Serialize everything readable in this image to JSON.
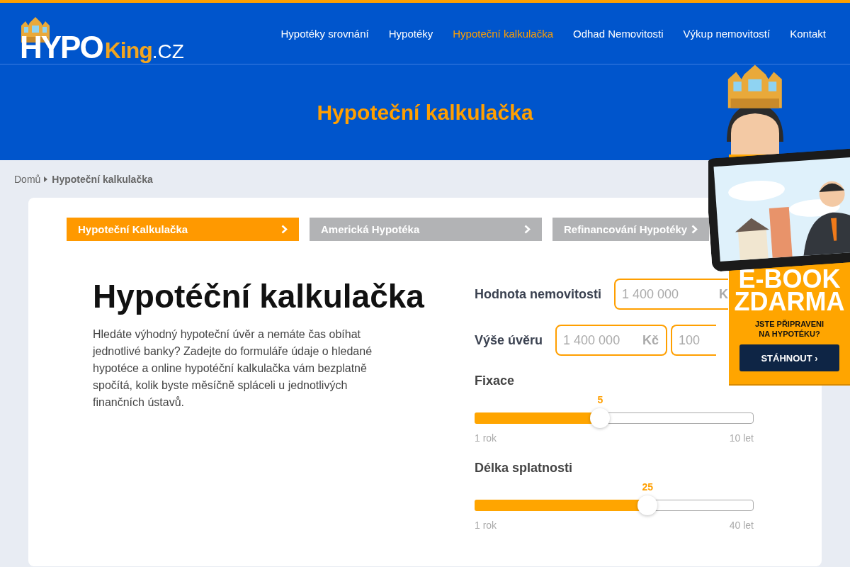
{
  "logo": {
    "part_1": "HYPO",
    "part_2": "King",
    "part_3": ".CZ"
  },
  "nav": [
    {
      "label": "Hypotéky srovnání",
      "selected": false
    },
    {
      "label": "Hypotéky",
      "selected": false
    },
    {
      "label": "Hypoteční kalkulačka",
      "selected": true
    },
    {
      "label": "Odhad Nemovitosti",
      "selected": false
    },
    {
      "label": "Výkup nemovitostí",
      "selected": false
    },
    {
      "label": "Kontakt",
      "selected": false
    }
  ],
  "hero": {
    "title": "Hypoteční kalkulačka"
  },
  "breadcrumb": [
    {
      "label": "Domů"
    },
    {
      "label": "Hypoteční kalkulačka"
    }
  ],
  "tabs": [
    {
      "label": "Hypoteční Kalkulačka",
      "selected": true
    },
    {
      "label": "Americká Hypotéka",
      "selected": false
    },
    {
      "label": "Refinancování Hypotéky",
      "selected": false
    }
  ],
  "intro": {
    "title": "Hypotéční kalkulačka",
    "text": "Hledáte výhodný hypoteční úvěr a nemáte čas obíhat jednotlivé banky? Zadejte do formuláře údaje o hledané hypotéce a online hypotéční kalkulačka vám bezplatně spočítá, kolik byste měsíčně spláceli u jednotlivých finančních ústavů."
  },
  "form": [
    {
      "kind": "fields",
      "label": "Hodnota nemovitosti",
      "fields": [
        {
          "placeholder": "1 400 000",
          "unit": "K"
        }
      ]
    },
    {
      "kind": "fields",
      "label": "Výše úvěru",
      "fields": [
        {
          "placeholder": "1 400 000",
          "unit": "Kč"
        },
        {
          "placeholder": "100"
        }
      ]
    },
    {
      "kind": "slider",
      "label": "Fixace",
      "value": "5",
      "level": 0.45,
      "min_label": "1 rok",
      "max_label": "10 let"
    },
    {
      "kind": "slider",
      "label": "Délka splatnosti",
      "value": "25",
      "level": 0.62,
      "min_label": "1 rok",
      "max_label": "40 let"
    }
  ],
  "ad": {
    "title_1": "E-BOOK",
    "title_2": "ZDARMA",
    "subtitle": "JSTE PŘIPRAVENI NA HYPOTÉKU?",
    "button": "STÁHNOUT ›"
  }
}
